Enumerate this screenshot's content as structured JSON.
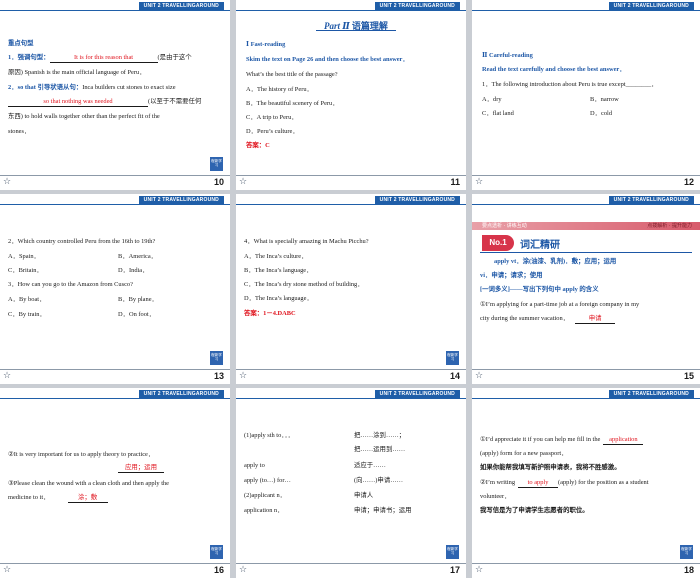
{
  "header_tag": "UNIT 2   TRAVELLINGAROUND",
  "logo_text": "程新学习",
  "footer_icon": "star-icon",
  "slides": [
    {
      "page": "10",
      "lines": {
        "l1": "重点句型",
        "l2_num": "1．",
        "l2_label": "强调句型：",
        "l2_ans": "It is for this reason that",
        "l2_tail": "(是由于这个",
        "l3": "原因) Spanish is the main official language of Peru．",
        "l4_num": "2．",
        "l4_a": "so that",
        "l4_b": "引导状语从句：",
        "l4_c": "Inca builders cut stones to exact size",
        "l5_ans": "so that nothing was needed",
        "l5_tail": "(以至于不需要任何",
        "l6": "东西) to hold walls together other than the perfect fit of the",
        "l7": "stones．"
      }
    },
    {
      "page": "11",
      "part": "Part Ⅱ",
      "part_sub": "语篇理解",
      "lines": {
        "l1": "Ⅰ  Fast-reading",
        "l2": "Skim the text on Page 26 and then choose the best answer．",
        "l3": "What’s the best title of the passage?",
        "l4": "A．The history of Peru．",
        "l5": "B．The beautiful scenery of Peru．",
        "l6": "C．A trip to Peru．",
        "l7": "D．Peru’s culture．",
        "l8": "答案：C"
      }
    },
    {
      "page": "12",
      "lines": {
        "l1": "Ⅱ  Careful-reading",
        "l2": "Read the text carefully and choose the best answer．",
        "l3": "1．The following introduction about Peru is true except________．",
        "l4a": "A．dry",
        "l4b": "B．narrow",
        "l5a": "C．flat land",
        "l5b": "D．cold"
      }
    },
    {
      "page": "13",
      "lines": {
        "l1": "2．Which country controlled Peru from the 16th to 19th?",
        "l2a": "A．Spain．",
        "l2b": "B．America．",
        "l3a": "C．Britain．",
        "l3b": "D．India．",
        "l4": "3．How can you go to the Amazon from Cusco?",
        "l5a": "A．By boat．",
        "l5b": "B．By plane．",
        "l6a": "C．By train．",
        "l6b": "D．On foot．"
      }
    },
    {
      "page": "14",
      "lines": {
        "l1": "4．What is specially amazing in Machu Picchu?",
        "l2": "A．The Inca’s culture．",
        "l3": "B．The Inca’s language．",
        "l4": "C．The Inca’s dry stone method of building．",
        "l5": "D．The Inca’s language．",
        "l6": "答案：1－4.DABC"
      }
    },
    {
      "page": "15",
      "banner_left": "要点透析 · 讲练互动",
      "banner_right": "点拨解析 · 提升能力",
      "no_label": "No.1",
      "vocab_title": "词汇精研",
      "lines": {
        "l1": "apply    vt．涂(油漆、乳剂)．敷；应用；运用",
        "l2": "vi．申请；请求；使用",
        "l3": "[一词多义]——写出下列句中 apply 的含义",
        "l4": "①I’m applying for a part-time job at a foreign company in my",
        "l5": "city during the summer vacation．",
        "l5_ans": "申请"
      }
    },
    {
      "page": "16",
      "lines": {
        "l1": "②It is very important for us to apply theory to practice．",
        "l1_ans": "应用；运用",
        "l2": "③Please clean the wound with a clean cloth and then apply the",
        "l3": "medicine to it．",
        "l3_ans": "涂；敷"
      }
    },
    {
      "page": "17",
      "rows": [
        {
          "left": "(1)apply sth to．．．",
          "right": "把……涂到……；"
        },
        {
          "left": "",
          "right": "把……运用到……"
        },
        {
          "left": "apply to",
          "right": "适应于……"
        },
        {
          "left": "apply (to…) for…",
          "right": "(向……)申请……"
        },
        {
          "left": "(2)applicant n．",
          "right": "申请人"
        },
        {
          "left": "application n．",
          "right": "申请；申请书；运用"
        }
      ]
    },
    {
      "page": "18",
      "lines": {
        "l1": "①I’d appreciate it if you can help me fill in the",
        "l1_ans": "application",
        "l2": "(apply) form for a new passport．",
        "l3": "如果你能帮我填写新护照申请表，我将不胜感激。",
        "l4": "②I’m writing",
        "l4_ans": "to apply",
        "l4_tail": "(apply) for the position as a student",
        "l5": "volunteer．",
        "l6": "我写信是为了申请学生志愿者的职位。"
      }
    }
  ]
}
